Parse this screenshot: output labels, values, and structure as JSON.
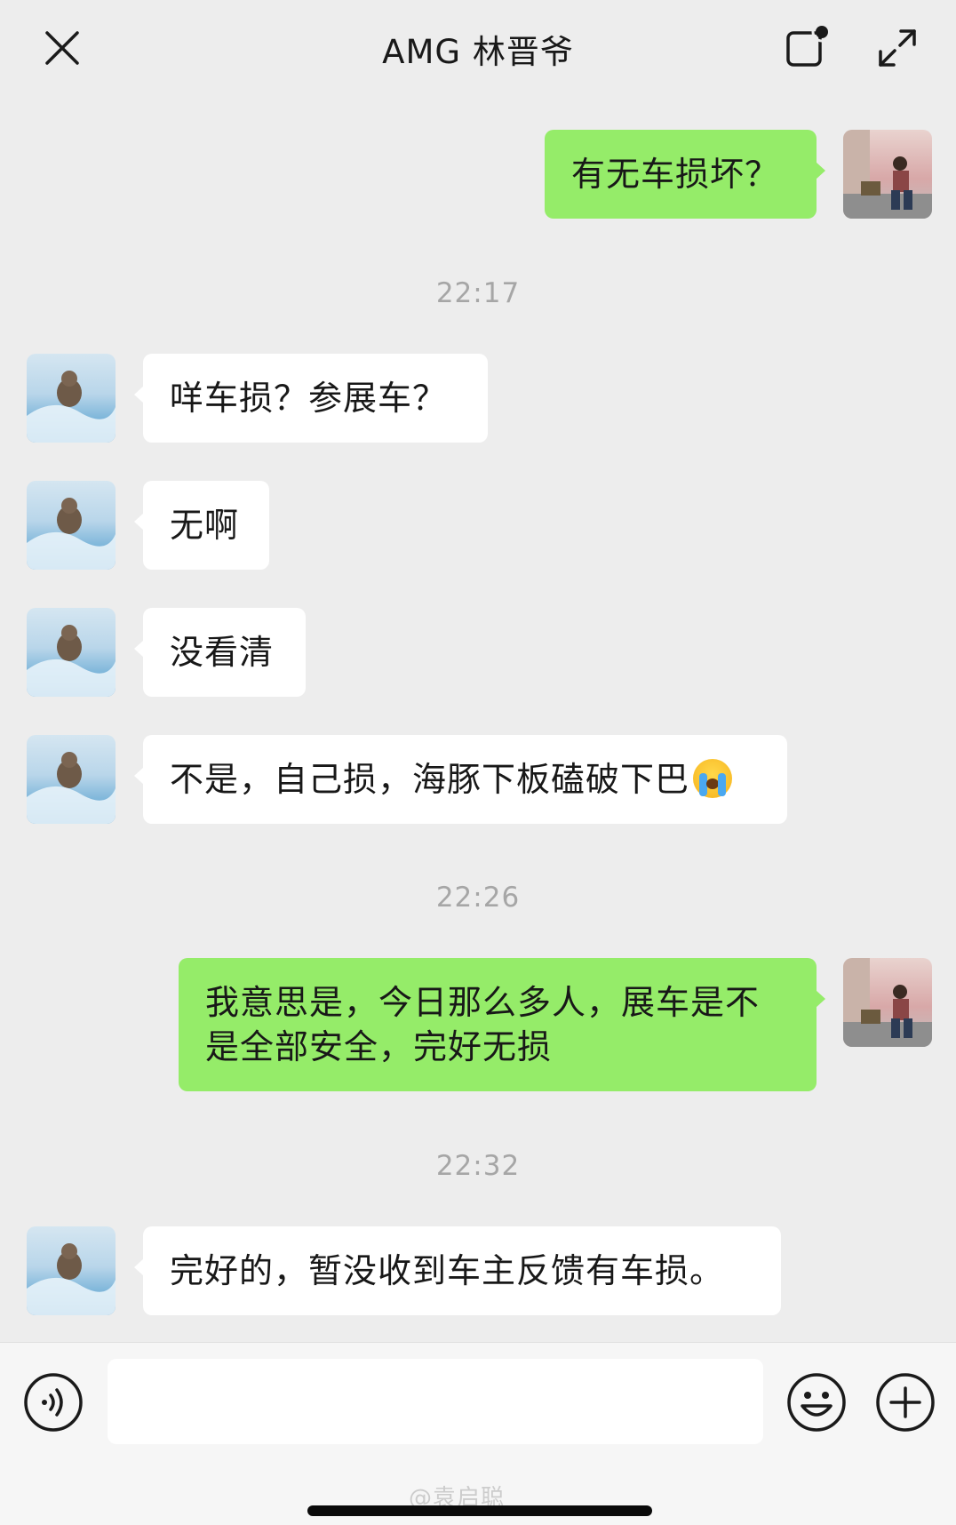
{
  "header": {
    "title": "AMG  林晋爷",
    "close_icon": "close-icon",
    "note_icon": "note-icon",
    "expand_icon": "expand-icon"
  },
  "messages": [
    {
      "type": "out",
      "text": "有无车损坏？"
    },
    {
      "type": "time",
      "text": "22:17"
    },
    {
      "type": "in",
      "text": "咩车损？参展车？"
    },
    {
      "type": "in",
      "text": "无啊"
    },
    {
      "type": "in",
      "text": "没看清"
    },
    {
      "type": "in",
      "text": "不是，自己损，海豚下板磕破下巴",
      "emoji": "crying-face"
    },
    {
      "type": "time",
      "text": "22:26"
    },
    {
      "type": "out",
      "line1": "我意思是，今日那么多人，展车是不",
      "line2": "是全部安全，完好无损"
    },
    {
      "type": "time",
      "text": "22:32"
    },
    {
      "type": "in",
      "text": "完好的，暂没收到车主反馈有车损。"
    }
  ],
  "input_bar": {
    "placeholder": "",
    "voice_icon": "voice-icon",
    "emoji_icon": "smile-icon",
    "plus_icon": "plus-icon"
  },
  "watermark": "@袁启聪",
  "colors": {
    "background": "#ededed",
    "outgoing_bubble": "#95ec69",
    "incoming_bubble": "#ffffff",
    "timestamp": "#a6a6a6"
  }
}
